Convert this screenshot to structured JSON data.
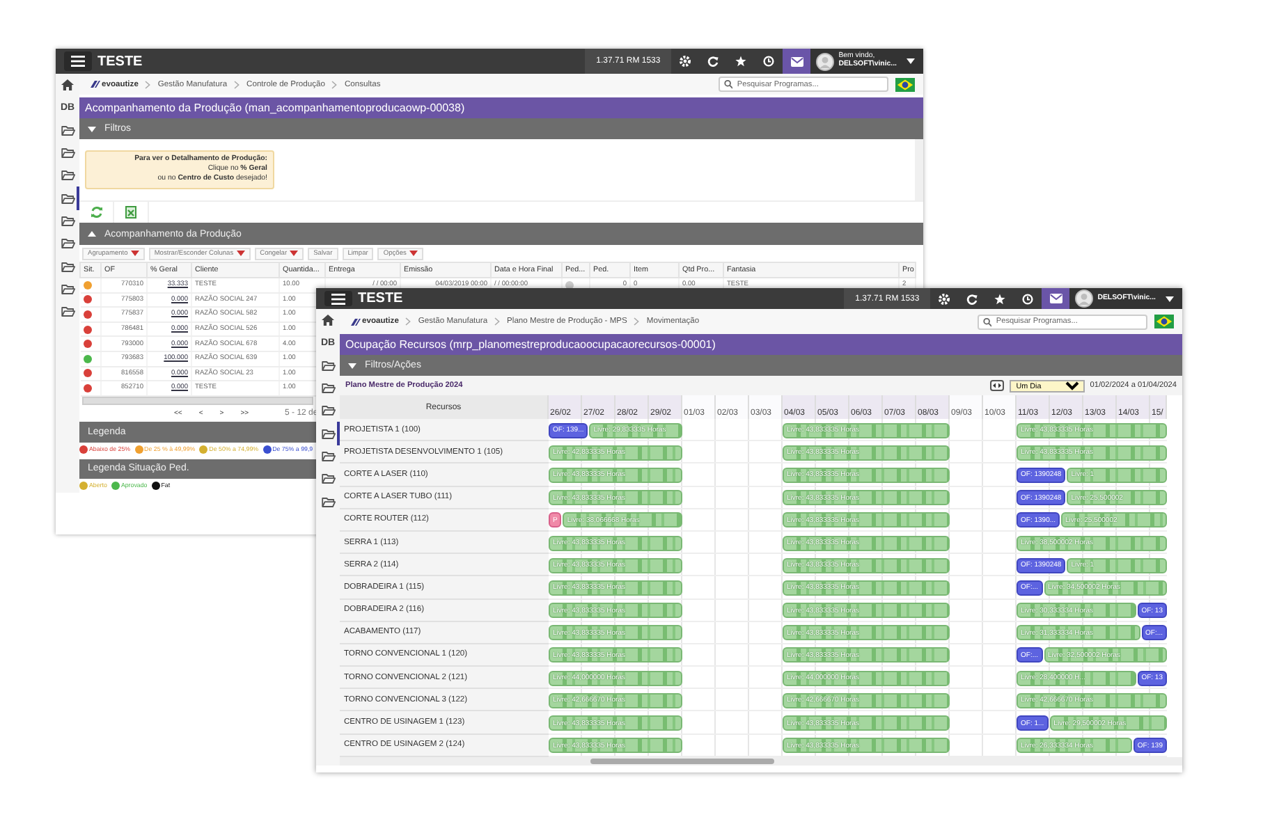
{
  "production_window": {
    "header": {
      "app_name": "TESTE",
      "version": "1.37.71 RM 1533",
      "greeting": "Bem vindo,",
      "user": "DELSOFT\\vinic..."
    },
    "breadcrumb": {
      "logo": "evoautize",
      "items": [
        "Gestão Manufatura",
        "Controle de Produção",
        "Consultas"
      ]
    },
    "search": {
      "placeholder": "Pesquisar Programas..."
    },
    "sidebar": [
      {
        "kind": "home",
        "selected": false
      },
      {
        "kind": "db",
        "label": "DB",
        "selected": false
      },
      {
        "kind": "folder",
        "selected": false
      },
      {
        "kind": "folder",
        "selected": false
      },
      {
        "kind": "folder",
        "selected": false
      },
      {
        "kind": "folder",
        "selected": true
      },
      {
        "kind": "folder",
        "selected": false
      },
      {
        "kind": "folder",
        "selected": false
      },
      {
        "kind": "folder",
        "selected": false
      },
      {
        "kind": "folder",
        "selected": false
      },
      {
        "kind": "folder",
        "selected": false
      }
    ],
    "title": "Acompanhamento da Produção (man_acompanhamentoproducaowp-00038)",
    "filters_label": "Filtros",
    "info": [
      "**Para ver o Detalhamento de Produção:**",
      "Clique no **% Geral**",
      "ou no **Centro de Custo** desejado!"
    ],
    "section_label": "Acompanhamento da Produção",
    "toolbar": [
      {
        "label": "Agrupamento",
        "dropdown": true
      },
      {
        "label": "Mostrar/Esconder Colunas",
        "dropdown": true
      },
      {
        "label": "Congelar",
        "dropdown": true
      },
      {
        "label": "Salvar",
        "dropdown": false
      },
      {
        "label": "Limpar",
        "dropdown": false
      },
      {
        "label": "Opções",
        "dropdown": true
      }
    ],
    "columns": [
      {
        "label": "Sit.",
        "kind": "status"
      },
      {
        "label": "OF",
        "kind": "number"
      },
      {
        "label": "% Geral",
        "kind": "link"
      },
      {
        "label": "Cliente",
        "kind": "text"
      },
      {
        "label": "Quantida...",
        "kind": "text"
      },
      {
        "label": "Entrega",
        "kind": "number"
      },
      {
        "label": "Emissão",
        "kind": "number"
      },
      {
        "label": "Data e Hora Final",
        "kind": "text"
      },
      {
        "label": "Ped...",
        "kind": "dot"
      },
      {
        "label": "Ped.",
        "kind": "number"
      },
      {
        "label": "Item",
        "kind": "text"
      },
      {
        "label": "Qtd Pro...",
        "kind": "text"
      },
      {
        "label": "Fantasia",
        "kind": "text"
      },
      {
        "label": "Pro",
        "kind": "text"
      }
    ],
    "rows": [
      {
        "color": "#f0a030",
        "ped_marked": true,
        "cells": [
          "",
          "770310",
          "33.333",
          "TESTE",
          "10.00",
          "/ / 00:00",
          "04/03/2019 00:00",
          "/ / 00:00:00",
          "",
          "0",
          "0",
          "0.00",
          "TESTE",
          "2"
        ]
      },
      {
        "color": "#d9403a",
        "cells": [
          "",
          "775803",
          "0.000",
          "RAZÃO SOCIAL 247",
          "1.00"
        ]
      },
      {
        "color": "#d9403a",
        "cells": [
          "",
          "775837",
          "0.000",
          "RAZÃO SOCIAL 582",
          "1.00"
        ]
      },
      {
        "color": "#d9403a",
        "cells": [
          "",
          "786481",
          "0.000",
          "RAZÃO SOCIAL 526",
          "1.00"
        ]
      },
      {
        "color": "#d9403a",
        "cells": [
          "",
          "793000",
          "0.000",
          "RAZÃO SOCIAL 678",
          "4.00"
        ]
      },
      {
        "color": "#4cb84c",
        "cells": [
          "",
          "793683",
          "100.000",
          "RAZÃO SOCIAL 639",
          "1.00"
        ]
      },
      {
        "color": "#d9403a",
        "cells": [
          "",
          "816558",
          "0.000",
          "RAZÃO SOCIAL 23",
          "1.00"
        ]
      },
      {
        "color": "#d9403a",
        "cells": [
          "",
          "852710",
          "0.000",
          "TESTE",
          "1.00"
        ]
      }
    ],
    "pagination": {
      "buttons": [
        "<<",
        "<",
        ">",
        ">>"
      ],
      "summary": "5 - 12 de"
    },
    "legend": {
      "title": "Legenda",
      "items": [
        {
          "label": "Abaixo de 25%",
          "color": "#d9403a"
        },
        {
          "label": "De 25 % à 49,99%",
          "color": "#f0a030"
        },
        {
          "label": "De 50% a 74,99%",
          "color": "#d4b030"
        },
        {
          "label": "De 75% a 99,9",
          "color": "#3a4fd0"
        }
      ]
    },
    "situation_legend": {
      "title": "Legenda Situação Ped.",
      "items": [
        {
          "label": "Aberto",
          "color": "#d4b030"
        },
        {
          "label": "Aprovado",
          "color": "#4cb84c"
        },
        {
          "label": "Fat",
          "color": "#111111"
        }
      ]
    }
  },
  "resources_window": {
    "header": {
      "app_name": "TESTE",
      "version": "1.37.71 RM 1533",
      "user": "DELSOFT\\vinic..."
    },
    "breadcrumb": {
      "logo": "evoautize",
      "items": [
        "Gestão Manufatura",
        "Plano Mestre de Produção - MPS",
        "Movimentação"
      ]
    },
    "search": {
      "placeholder": "Pesquisar Programas..."
    },
    "sidebar": [
      {
        "kind": "home",
        "selected": false
      },
      {
        "kind": "db",
        "label": "DB",
        "selected": false
      },
      {
        "kind": "folder",
        "selected": false
      },
      {
        "kind": "folder",
        "selected": false
      },
      {
        "kind": "folder",
        "selected": false
      },
      {
        "kind": "folder",
        "selected": true
      },
      {
        "kind": "folder",
        "selected": false
      },
      {
        "kind": "folder",
        "selected": false
      },
      {
        "kind": "folder",
        "selected": false
      }
    ],
    "title": "Ocupação Recursos (mrp_planomestreproducaoocupacaorecursos-00001)",
    "filters_label": "Filtros/Ações",
    "gantt": {
      "title": "Plano Mestre de Produção 2024",
      "scale": "Um Dia",
      "range": "01/02/2024 a 01/04/2024",
      "resource_header": "Recursos",
      "days": [
        {
          "label": "26/02",
          "workday": true
        },
        {
          "label": "27/02",
          "workday": true
        },
        {
          "label": "28/02",
          "workday": true
        },
        {
          "label": "29/02",
          "workday": true
        },
        {
          "label": "01/03",
          "workday": false
        },
        {
          "label": "02/03",
          "workday": false
        },
        {
          "label": "03/03",
          "workday": false
        },
        {
          "label": "04/03",
          "workday": true
        },
        {
          "label": "05/03",
          "workday": true
        },
        {
          "label": "06/03",
          "workday": true
        },
        {
          "label": "07/03",
          "workday": true
        },
        {
          "label": "08/03",
          "workday": true
        },
        {
          "label": "09/03",
          "workday": false
        },
        {
          "label": "10/03",
          "workday": false
        },
        {
          "label": "11/03",
          "workday": true
        },
        {
          "label": "12/03",
          "workday": true
        },
        {
          "label": "13/03",
          "workday": true
        },
        {
          "label": "14/03",
          "workday": true
        },
        {
          "label": "15/",
          "workday": true
        }
      ],
      "rows": [
        {
          "name": "PROJETISTA 1 (100)",
          "segments": [
            [
              {
                "kind": "order",
                "label": "OF: 139..."
              },
              {
                "kind": "free",
                "label": "Livre: 29,833335 Horas"
              }
            ],
            [
              {
                "kind": "free",
                "label": "Livre: 43,833335 Horas"
              }
            ],
            [
              {
                "kind": "free",
                "label": "Livre: 43,833335 Horas"
              }
            ]
          ]
        },
        {
          "name": "PROJETISTA DESENVOLVIMENTO 1 (105)",
          "segments": [
            [
              {
                "kind": "free",
                "label": "Livre: 42,833335 Horas"
              }
            ],
            [
              {
                "kind": "free",
                "label": "Livre: 43,833335 Horas"
              }
            ],
            [
              {
                "kind": "free",
                "label": "Livre: 43,833335 Horas"
              }
            ]
          ]
        },
        {
          "name": "CORTE A LASER (110)",
          "segments": [
            [
              {
                "kind": "free",
                "label": "Livre: 43,833335 Horas"
              }
            ],
            [
              {
                "kind": "free",
                "label": "Livre: 43,833335 Horas"
              }
            ],
            [
              {
                "kind": "order",
                "label": "OF: 1390248"
              },
              {
                "kind": "free",
                "label": "Livre: 1"
              }
            ]
          ]
        },
        {
          "name": "CORTE A LASER TUBO (111)",
          "segments": [
            [
              {
                "kind": "free",
                "label": "Livre: 43,833335 Horas"
              }
            ],
            [
              {
                "kind": "free",
                "label": "Livre: 43,833335 Horas"
              }
            ],
            [
              {
                "kind": "order",
                "label": "OF: 1390248"
              },
              {
                "kind": "free",
                "label": "Livre: 25,500002"
              }
            ]
          ]
        },
        {
          "name": "CORTE ROUTER (112)",
          "segments": [
            [
              {
                "kind": "pending",
                "label": "P"
              },
              {
                "kind": "free",
                "label": "Livre: 38,066668 Horas"
              }
            ],
            [
              {
                "kind": "free",
                "label": "Livre: 43,833335 Horas"
              }
            ],
            [
              {
                "kind": "order",
                "label": "OF: 1390..."
              },
              {
                "kind": "free",
                "label": "Livre: 25,500002"
              }
            ]
          ]
        },
        {
          "name": "SERRA 1 (113)",
          "segments": [
            [
              {
                "kind": "free",
                "label": "Livre: 43,833335 Horas"
              }
            ],
            [
              {
                "kind": "free",
                "label": "Livre: 43,833335 Horas"
              }
            ],
            [
              {
                "kind": "free",
                "label": "Livre: 38,500002 Horas"
              }
            ]
          ]
        },
        {
          "name": "SERRA 2 (114)",
          "segments": [
            [
              {
                "kind": "free",
                "label": "Livre: 43,833335 Horas"
              }
            ],
            [
              {
                "kind": "free",
                "label": "Livre: 43,833335 Horas"
              }
            ],
            [
              {
                "kind": "order",
                "label": "OF: 1390248"
              },
              {
                "kind": "free",
                "label": "Livre: 1"
              }
            ]
          ]
        },
        {
          "name": "DOBRADEIRA 1 (115)",
          "segments": [
            [
              {
                "kind": "free",
                "label": "Livre: 43,833335 Horas"
              }
            ],
            [
              {
                "kind": "free",
                "label": "Livre: 43,833335 Horas"
              }
            ],
            [
              {
                "kind": "order",
                "label": "OF:..."
              },
              {
                "kind": "free",
                "label": "Livre: 34,500002 Horas"
              }
            ]
          ]
        },
        {
          "name": "DOBRADEIRA 2 (116)",
          "segments": [
            [
              {
                "kind": "free",
                "label": "Livre: 43,833335 Horas"
              }
            ],
            [
              {
                "kind": "free",
                "label": "Livre: 43,833335 Horas"
              }
            ],
            [
              {
                "kind": "free",
                "label": "Livre: 30,333334 Horas"
              },
              {
                "kind": "order",
                "label": "OF: 13"
              }
            ]
          ]
        },
        {
          "name": "ACABAMENTO (117)",
          "segments": [
            [
              {
                "kind": "free",
                "label": "Livre: 43,833335 Horas"
              }
            ],
            [
              {
                "kind": "free",
                "label": "Livre: 43,833335 Horas"
              }
            ],
            [
              {
                "kind": "free",
                "label": "Livre: 31,333334 Horas"
              },
              {
                "kind": "order",
                "label": "OF:..."
              }
            ]
          ]
        },
        {
          "name": "TORNO CONVENCIONAL 1 (120)",
          "segments": [
            [
              {
                "kind": "free",
                "label": "Livre: 43,833335 Horas"
              }
            ],
            [
              {
                "kind": "free",
                "label": "Livre: 43,833335 Horas"
              }
            ],
            [
              {
                "kind": "order",
                "label": "OF:..."
              },
              {
                "kind": "free",
                "label": "Livre: 32,500002 Horas"
              }
            ]
          ]
        },
        {
          "name": "TORNO CONVENCIONAL 2 (121)",
          "segments": [
            [
              {
                "kind": "free",
                "label": "Livre: 44,000000 Horas"
              }
            ],
            [
              {
                "kind": "free",
                "label": "Livre: 44,000000 Horas"
              }
            ],
            [
              {
                "kind": "free",
                "label": "Livre: 28,400000 H..."
              },
              {
                "kind": "order",
                "label": "OF: 13"
              }
            ]
          ]
        },
        {
          "name": "TORNO CONVENCIONAL 3 (122)",
          "segments": [
            [
              {
                "kind": "free",
                "label": "Livre: 42,666670 Horas"
              }
            ],
            [
              {
                "kind": "free",
                "label": "Livre: 42,666670 Horas"
              }
            ],
            [
              {
                "kind": "free",
                "label": "Livre: 42,666670 Horas"
              }
            ]
          ]
        },
        {
          "name": "CENTRO DE USINAGEM 1 (123)",
          "segments": [
            [
              {
                "kind": "free",
                "label": "Livre: 43,833335 Horas"
              }
            ],
            [
              {
                "kind": "free",
                "label": "Livre: 43,833335 Horas"
              }
            ],
            [
              {
                "kind": "order",
                "label": "OF: 1..."
              },
              {
                "kind": "free",
                "label": "Livre: 29,500002 Horas"
              }
            ]
          ]
        },
        {
          "name": "CENTRO DE USINAGEM 2 (124)",
          "segments": [
            [
              {
                "kind": "free",
                "label": "Livre: 43,833335 Horas"
              }
            ],
            [
              {
                "kind": "free",
                "label": "Livre: 43,833335 Horas"
              }
            ],
            [
              {
                "kind": "free",
                "label": "Livre: 26,333334 Horas"
              },
              {
                "kind": "order",
                "label": "OF: 139"
              }
            ]
          ]
        }
      ]
    }
  }
}
